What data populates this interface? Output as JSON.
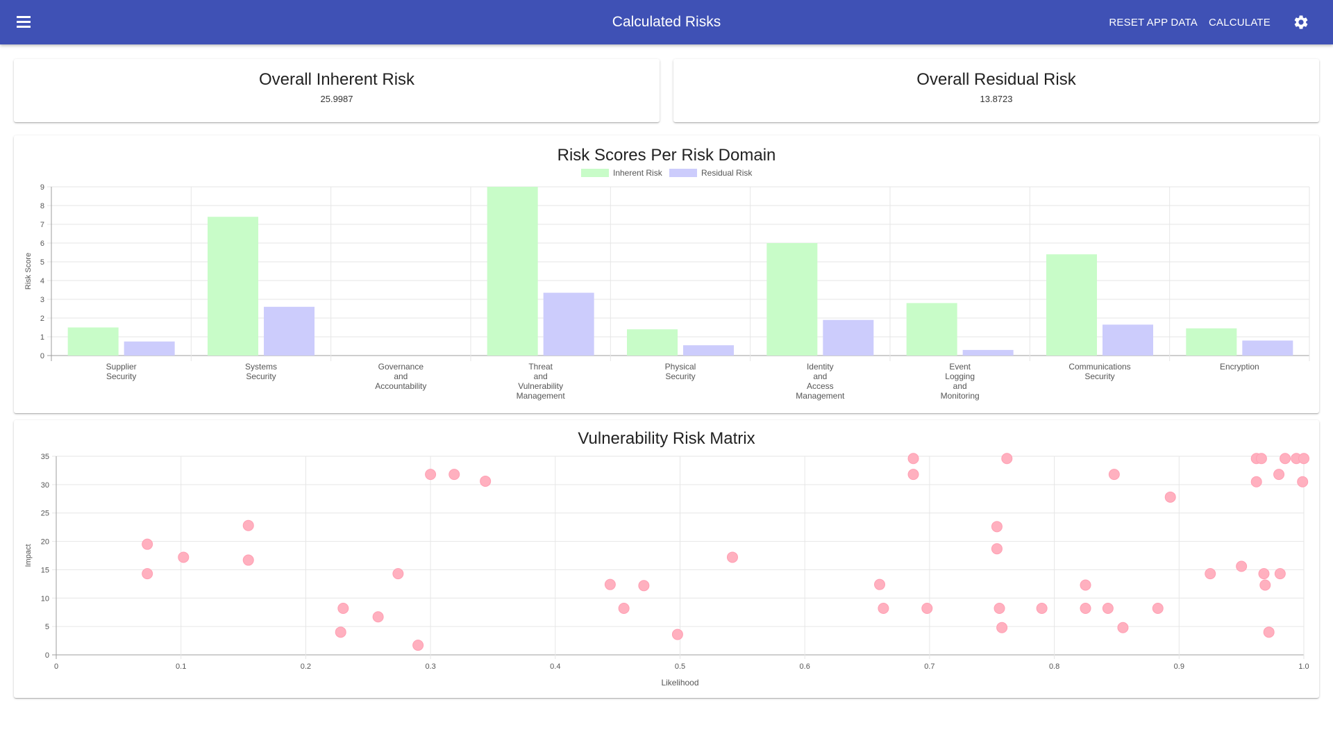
{
  "appbar": {
    "title": "Calculated Risks",
    "reset_label": "RESET APP DATA",
    "calculate_label": "CALCULATE",
    "menu_icon": "menu-icon",
    "settings_icon": "gear-icon",
    "color": "#3f51b5"
  },
  "kpis": {
    "inherent": {
      "title": "Overall Inherent Risk",
      "value": "25.9987"
    },
    "residual": {
      "title": "Overall Residual Risk",
      "value": "13.8723"
    }
  },
  "chart_data": [
    {
      "type": "bar",
      "title": "Risk Scores Per Risk Domain",
      "ylabel": "Risk Score",
      "xlabel": "",
      "ylim": [
        0,
        9
      ],
      "yticks": [
        0,
        1,
        2,
        3,
        4,
        5,
        6,
        7,
        8,
        9
      ],
      "legend": "top-center",
      "grid": true,
      "categories": [
        [
          "Supplier",
          "Security"
        ],
        [
          "Systems",
          "Security"
        ],
        [
          "Governance",
          "and",
          "Accountability"
        ],
        [
          "Threat",
          "and",
          "Vulnerability",
          "Management"
        ],
        [
          "Physical",
          "Security"
        ],
        [
          "Identity",
          "and",
          "Access",
          "Management"
        ],
        [
          "Event",
          "Logging",
          "and",
          "Monitoring"
        ],
        [
          "Communications",
          "Security"
        ],
        [
          "Encryption"
        ]
      ],
      "series": [
        {
          "name": "Inherent Risk",
          "color": "#c8fcc8",
          "values": [
            1.5,
            7.4,
            0,
            9.0,
            1.4,
            6.0,
            2.8,
            5.4,
            1.45
          ]
        },
        {
          "name": "Residual Risk",
          "color": "#ccccfc",
          "values": [
            0.75,
            2.6,
            0,
            3.35,
            0.55,
            1.9,
            0.3,
            1.65,
            0.8
          ]
        }
      ]
    },
    {
      "type": "scatter",
      "title": "Vulnerability Risk Matrix",
      "xlabel": "Likelihood",
      "ylabel": "Impact",
      "xlim": [
        0,
        1
      ],
      "ylim": [
        0,
        35
      ],
      "xticks": [
        "0",
        "0.1",
        "0.2",
        "0.3",
        "0.4",
        "0.5",
        "0.6",
        "0.7",
        "0.8",
        "0.9",
        "1.0"
      ],
      "yticks": [
        0,
        5,
        10,
        15,
        20,
        25,
        30,
        35
      ],
      "grid": true,
      "color": "#ffb0bf",
      "points": [
        [
          0.073,
          19.5
        ],
        [
          0.073,
          14.3
        ],
        [
          0.102,
          17.2
        ],
        [
          0.154,
          22.8
        ],
        [
          0.154,
          16.7
        ],
        [
          0.228,
          4.0
        ],
        [
          0.23,
          8.2
        ],
        [
          0.258,
          6.7
        ],
        [
          0.274,
          14.3
        ],
        [
          0.29,
          1.7
        ],
        [
          0.3,
          31.8
        ],
        [
          0.319,
          31.8
        ],
        [
          0.344,
          30.6
        ],
        [
          0.444,
          12.4
        ],
        [
          0.455,
          8.2
        ],
        [
          0.471,
          12.2
        ],
        [
          0.498,
          3.6
        ],
        [
          0.542,
          17.2
        ],
        [
          0.66,
          12.4
        ],
        [
          0.663,
          8.2
        ],
        [
          0.687,
          34.6
        ],
        [
          0.687,
          31.8
        ],
        [
          0.698,
          8.2
        ],
        [
          0.754,
          22.6
        ],
        [
          0.754,
          18.7
        ],
        [
          0.756,
          8.2
        ],
        [
          0.758,
          4.8
        ],
        [
          0.762,
          34.6
        ],
        [
          0.79,
          8.2
        ],
        [
          0.825,
          12.3
        ],
        [
          0.825,
          8.2
        ],
        [
          0.843,
          8.2
        ],
        [
          0.848,
          31.8
        ],
        [
          0.855,
          4.8
        ],
        [
          0.883,
          8.2
        ],
        [
          0.893,
          27.8
        ],
        [
          0.925,
          14.3
        ],
        [
          0.95,
          15.6
        ],
        [
          0.962,
          34.6
        ],
        [
          0.962,
          30.5
        ],
        [
          0.966,
          34.6
        ],
        [
          0.968,
          14.3
        ],
        [
          0.969,
          12.3
        ],
        [
          0.972,
          4.0
        ],
        [
          0.98,
          31.8
        ],
        [
          0.981,
          14.3
        ],
        [
          0.985,
          34.6
        ],
        [
          0.994,
          34.6
        ],
        [
          0.999,
          30.5
        ],
        [
          1.0,
          34.6
        ]
      ]
    }
  ]
}
